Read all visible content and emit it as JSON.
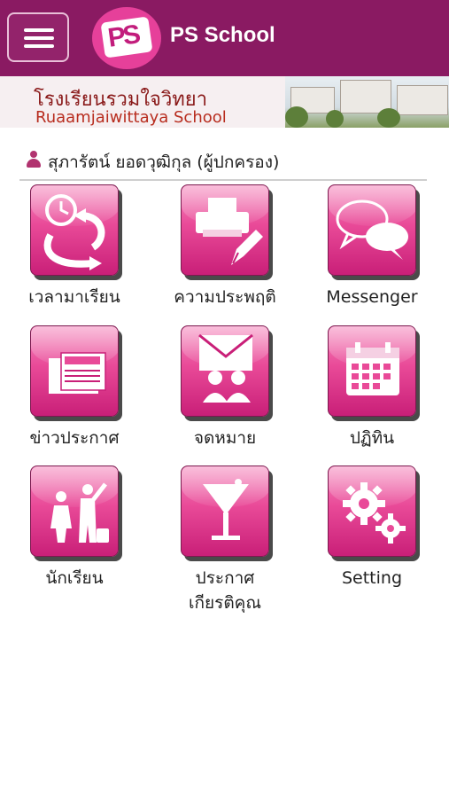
{
  "header": {
    "title": "PS School",
    "logo_text": "PS",
    "logo_sub": "School",
    "menu_icon": "hamburger-menu-icon",
    "bar_color": "#8a1a62"
  },
  "banner": {
    "school_name_th": "โรงเรียนรวมใจวิทยา",
    "school_name_en": "Ruaamjaiwittaya School"
  },
  "user": {
    "name": "สุภารัตน์ ยอดวุฒิกุล (ผู้ปกครอง)",
    "icon": "user-icon"
  },
  "menu": {
    "items": [
      {
        "label": "เวลามาเรียน",
        "icon": "clock-arrow-icon"
      },
      {
        "label": "ความประพฤติ",
        "icon": "printer-pen-icon"
      },
      {
        "label": "Messenger",
        "icon": "chat-bubbles-icon"
      },
      {
        "label": "ข่าวประกาศ",
        "icon": "newspaper-icon"
      },
      {
        "label": "จดหมาย",
        "icon": "envelope-people-icon"
      },
      {
        "label": "ปฏิทิน",
        "icon": "calendar-icon"
      },
      {
        "label": "นักเรียน",
        "icon": "parent-child-icon"
      },
      {
        "label": "ประกาศ\nเกียรติคุณ",
        "label_line1": "ประกาศ",
        "label_line2": "เกียรติคุณ",
        "icon": "trophy-cup-icon"
      },
      {
        "label": "Setting",
        "icon": "gears-icon"
      }
    ]
  },
  "colors": {
    "accent": "#e94a98",
    "accent_dark": "#c91f78",
    "header": "#8a1a62"
  }
}
